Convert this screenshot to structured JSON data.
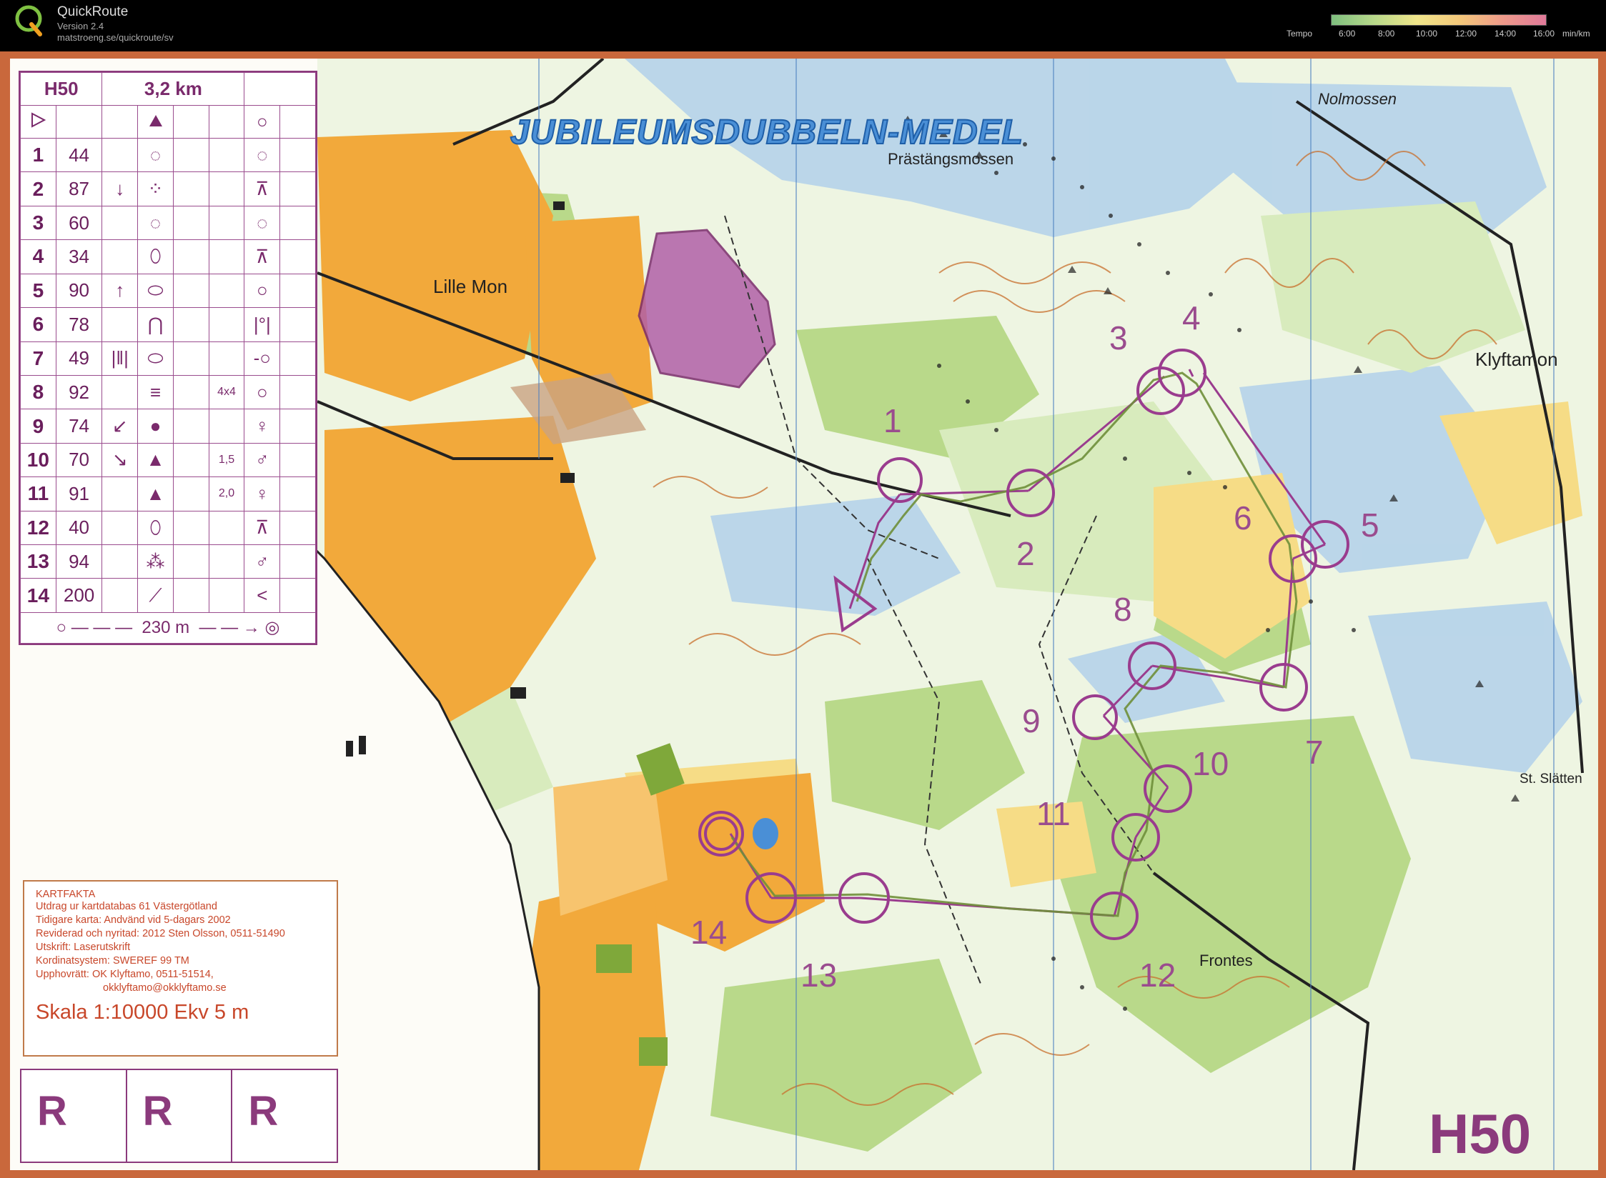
{
  "app": {
    "name": "QuickRoute",
    "version": "Version 2.4",
    "url": "matstroeng.se/quickroute/sv",
    "tempo_label": "Tempo",
    "tempo_ticks": [
      "6:00",
      "8:00",
      "10:00",
      "12:00",
      "14:00",
      "16:00"
    ],
    "tempo_unit": "min/km"
  },
  "control_description": {
    "class": "H50",
    "length": "3,2 km",
    "rows": [
      {
        "num": "1",
        "code": "44",
        "dir": "",
        "feature": "◌",
        "col5": "",
        "pos": "◌"
      },
      {
        "num": "2",
        "code": "87",
        "dir": "↓",
        "feature": "⁘",
        "col5": "",
        "pos": "⊼"
      },
      {
        "num": "3",
        "code": "60",
        "dir": "",
        "feature": "◌",
        "col5": "",
        "pos": "◌"
      },
      {
        "num": "4",
        "code": "34",
        "dir": "",
        "feature": "⬯",
        "col5": "",
        "pos": "⊼"
      },
      {
        "num": "5",
        "code": "90",
        "dir": "↑",
        "feature": "⬭",
        "col5": "",
        "pos": "○"
      },
      {
        "num": "6",
        "code": "78",
        "dir": "",
        "feature": "⋂",
        "col5": "",
        "pos": "|°|"
      },
      {
        "num": "7",
        "code": "49",
        "dir": "|‖|",
        "feature": "⬭",
        "col5": "",
        "pos": "-○"
      },
      {
        "num": "8",
        "code": "92",
        "dir": "",
        "feature": "≡",
        "col5": "4x4",
        "pos": "○"
      },
      {
        "num": "9",
        "code": "74",
        "dir": "↙",
        "feature": "●",
        "col5": "",
        "pos": "♀"
      },
      {
        "num": "10",
        "code": "70",
        "dir": "↘",
        "feature": "▲",
        "col5": "1,5",
        "pos": "♂"
      },
      {
        "num": "11",
        "code": "91",
        "dir": "",
        "feature": "▲",
        "col5": "2,0",
        "pos": "♀"
      },
      {
        "num": "12",
        "code": "40",
        "dir": "",
        "feature": "⬯",
        "col5": "",
        "pos": "⊼"
      },
      {
        "num": "13",
        "code": "94",
        "dir": "",
        "feature": "⁂",
        "col5": "",
        "pos": "♂"
      },
      {
        "num": "14",
        "code": "200",
        "dir": "",
        "feature": "⟋",
        "col5": "",
        "pos": "<"
      }
    ],
    "finish_distance": "230 m"
  },
  "map": {
    "title": "JUBILEUMSDUBBELN-MEDEL",
    "place_names": [
      "Nolmossen",
      "Prästängsmossen",
      "Lille Mon",
      "Klyftamon",
      "St. Slätten",
      "Frontes"
    ],
    "class_label": "H50",
    "control_numbers": [
      "1",
      "2",
      "3",
      "4",
      "5",
      "6",
      "7",
      "8",
      "9",
      "10",
      "11",
      "12",
      "13",
      "14"
    ]
  },
  "kartfakta": {
    "title": "KARTFAKTA",
    "lines": [
      "Utdrag ur kartdatabas 61 Västergötland",
      "Tidigare karta: Andvänd vid 5-dagars 2002",
      "Reviderad och nyritad: 2012 Sten Olsson, 0511-51490",
      "Utskrift: Laserutskrift",
      "Kordinatsystem: SWEREF 99 TM",
      "Upphovrätt: OK Klyftamo, 0511-51514,",
      "okklyftamo@okklyftamo.se"
    ],
    "scale": "Skala 1:10000  Ekv 5 m"
  },
  "relay_boxes": [
    "R",
    "R",
    "R"
  ],
  "colors": {
    "course": "#9a3c8e",
    "route": "#6f8f3a",
    "open_land": "#f2a93b",
    "forest_green": "#b9d98a",
    "marsh_blue": "#a9cbe6",
    "frame_orange": "#c9683c"
  }
}
